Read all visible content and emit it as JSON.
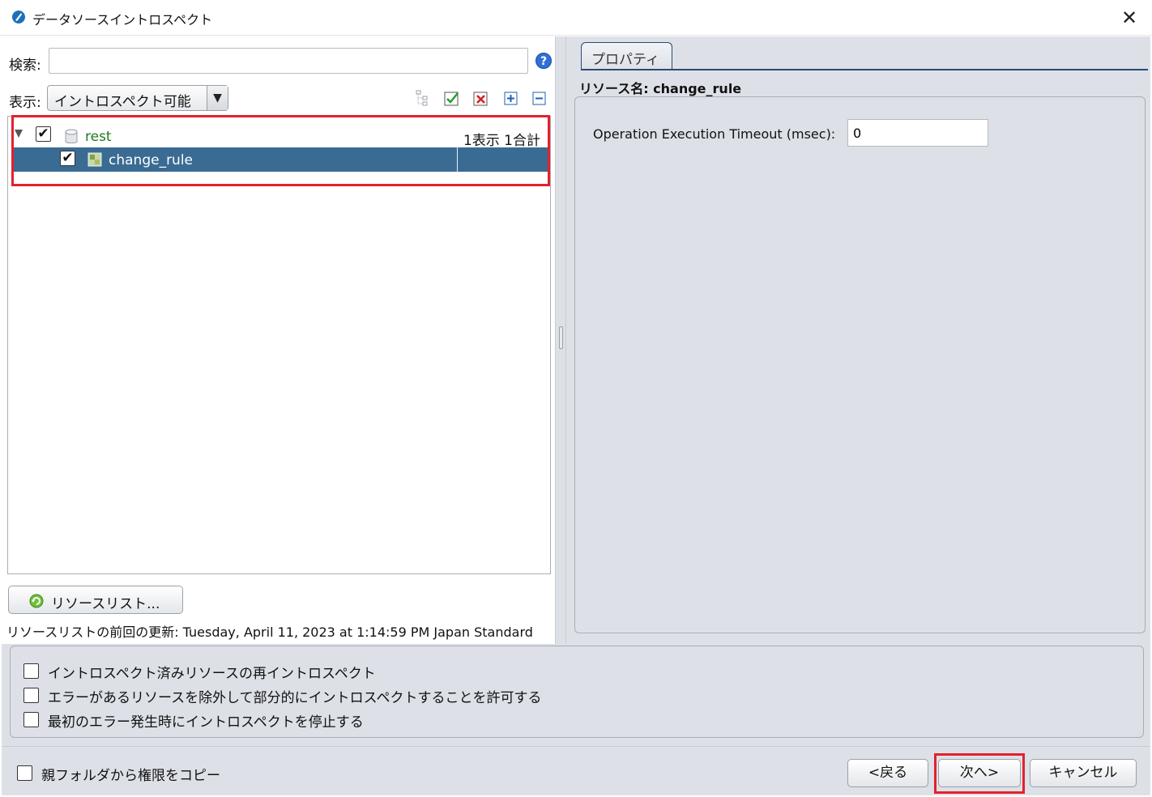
{
  "window": {
    "title": "データソースイントロスペクト",
    "close_label": "✕"
  },
  "search": {
    "label": "検索:",
    "value": "",
    "placeholder": "",
    "help_label": "?"
  },
  "display": {
    "label": "表示:",
    "selected": "イントロスペクト可能"
  },
  "tree": {
    "rest": {
      "label": "rest",
      "count": "1表示 1合計",
      "checked": "✔"
    },
    "change_rule": {
      "label": "change_rule",
      "checked": "✔"
    }
  },
  "resource_list_button": {
    "label": "リソースリスト..."
  },
  "last_update": {
    "text": "リソースリストの前回の更新: Tuesday, April 11, 2023 at 1:14:59 PM Japan Standard"
  },
  "properties": {
    "tab_label": "プロパティ",
    "resource_name": "リソース名: change_rule",
    "timeout_label": "Operation Execution Timeout (msec):",
    "timeout_value": "0"
  },
  "options": {
    "reintrospect": "イントロスペクト済みリソースの再イントロスペクト",
    "partial": "エラーがあるリソースを除外して部分的にイントロスペクトすることを許可する",
    "stop_on_error": "最初のエラー発生時にイントロスペクトを停止する"
  },
  "footer": {
    "copy_permissions": "親フォルダから権限をコピー",
    "back_label": "<戻る",
    "next_label": "次へ>",
    "cancel_label": "キャンセル"
  },
  "colors": {
    "selection": "#3a6b93",
    "highlight_box": "#e3212e",
    "rest_text": "#1f7a1f",
    "tab_border": "#2b4a73"
  }
}
